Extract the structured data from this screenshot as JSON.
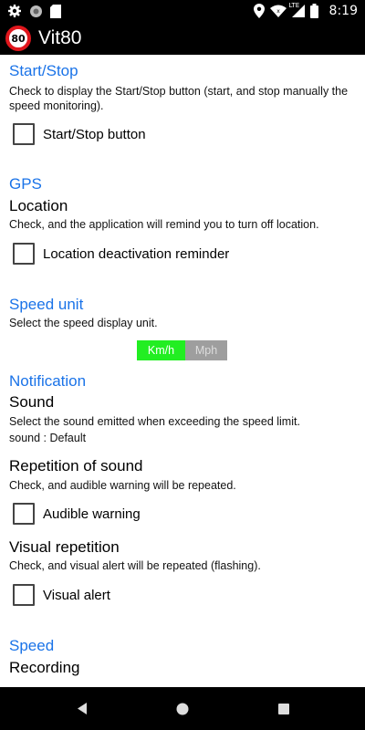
{
  "status_bar": {
    "time": "8:19",
    "network_type": "LTE",
    "left_icons": [
      "settings-icon",
      "circle-icon",
      "sd-card-icon"
    ],
    "right_icons": [
      "location-icon",
      "wifi-icon",
      "signal-icon",
      "battery-icon"
    ]
  },
  "app_bar": {
    "logo_text": "80",
    "title": "Vit80"
  },
  "sections": {
    "start_stop": {
      "title": "Start/Stop",
      "summary": "Check to display the Start/Stop button (start, and stop manually the speed monitoring).",
      "checkbox_label": "Start/Stop button",
      "checked": false
    },
    "gps": {
      "title": "GPS",
      "location_title": "Location",
      "location_summary": "Check, and the application will remind you to turn off location.",
      "checkbox_label": "Location deactivation reminder",
      "checked": false
    },
    "speed_unit": {
      "title": "Speed unit",
      "summary": "Select the speed display unit.",
      "options": [
        "Km/h",
        "Mph"
      ],
      "selected": "Km/h",
      "selected_color": "#22ee22",
      "unselected_color": "#9e9e9e"
    },
    "notification": {
      "title": "Notification",
      "sound_title": "Sound",
      "sound_summary": "Select the sound emitted when exceeding the speed limit.",
      "sound_value": "sound : Default",
      "repetition_title": "Repetition of sound",
      "repetition_summary": "Check, and audible warning will be repeated.",
      "audible_label": "Audible warning",
      "audible_checked": false,
      "visual_title": "Visual repetition",
      "visual_summary": "Check, and visual alert will be repeated (flashing).",
      "visual_label": "Visual alert",
      "visual_checked": false
    },
    "speed": {
      "title": "Speed",
      "recording_title": "Recording"
    }
  },
  "nav_bar": {
    "buttons": [
      "back-icon",
      "home-icon",
      "recents-icon"
    ]
  },
  "colors": {
    "accent": "#1a73e8",
    "bar_background": "#000000",
    "logo_ring": "#e0161c"
  }
}
